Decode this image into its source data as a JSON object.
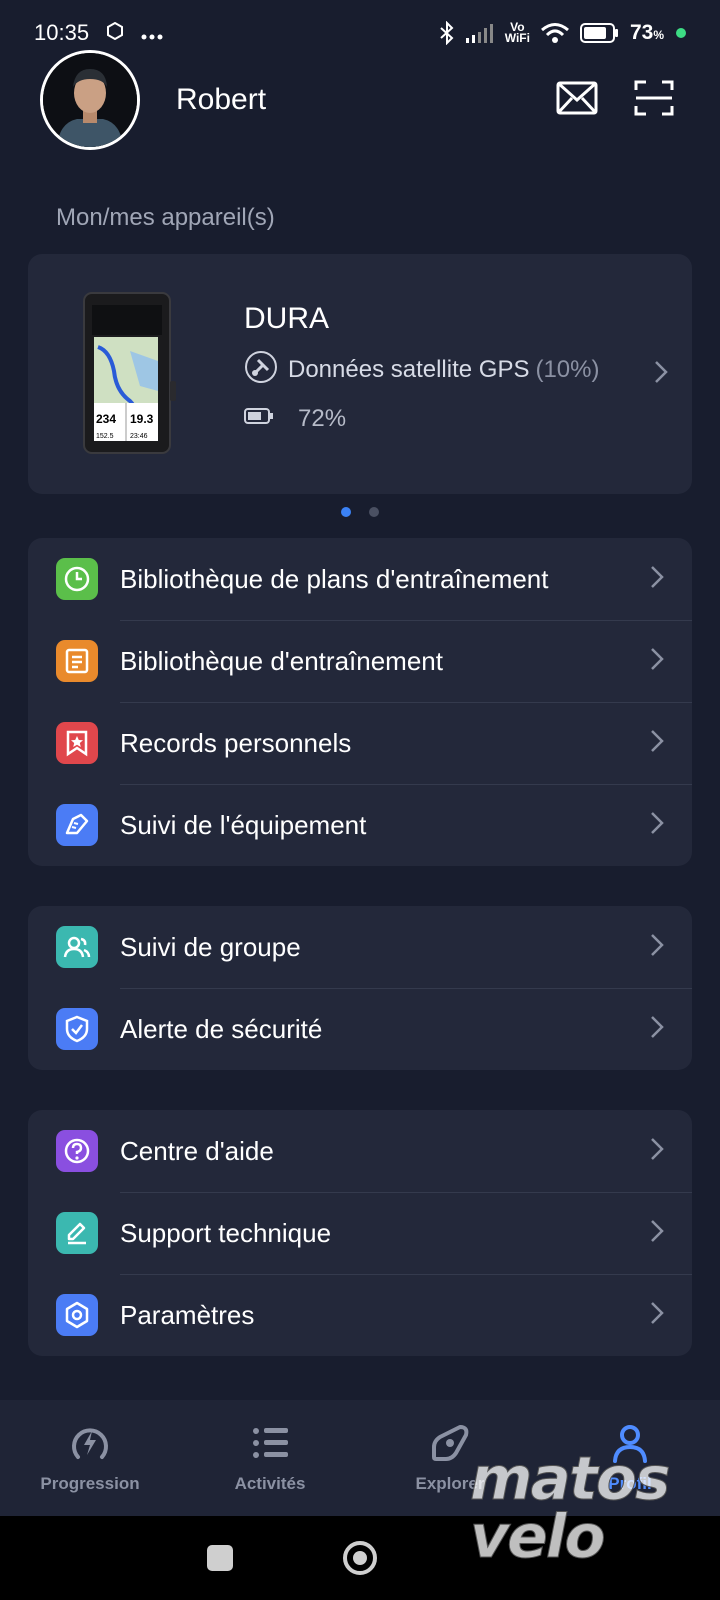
{
  "status_bar": {
    "time": "10:35",
    "vowifi_top": "Vo",
    "vowifi_bottom": "WiFi",
    "battery_percent": "73",
    "percent_sign": "%"
  },
  "header": {
    "username": "Robert",
    "icons": [
      "mail-icon",
      "scan-icon"
    ]
  },
  "devices_section": {
    "title": "Mon/mes appareil(s)",
    "device": {
      "name": "DURA",
      "gps_label": "Données satellite GPS",
      "gps_value": "(10%)",
      "battery": "72%",
      "screen_values": [
        "234",
        "19.3",
        "152.5",
        "23:46"
      ]
    },
    "pager": {
      "count": 2,
      "active": 0
    }
  },
  "menu_group_1": [
    {
      "label": "Bibliothèque de plans d'entraînement",
      "icon": "clock-icon",
      "color": "#5bbf4a"
    },
    {
      "label": "Bibliothèque d'entraînement",
      "icon": "document-icon",
      "color": "#e98a2c"
    },
    {
      "label": "Records personnels",
      "icon": "star-bookmark-icon",
      "color": "#e0474c"
    },
    {
      "label": "Suivi de l'équipement",
      "icon": "shoe-icon",
      "color": "#4b7cf5"
    }
  ],
  "menu_group_2": [
    {
      "label": "Suivi de groupe",
      "icon": "group-icon",
      "color": "#3bb8b0"
    },
    {
      "label": "Alerte de sécurité",
      "icon": "shield-check-icon",
      "color": "#4b7cf5"
    }
  ],
  "menu_group_3": [
    {
      "label": "Centre d'aide",
      "icon": "help-icon",
      "color": "#8a4fe0"
    },
    {
      "label": "Support technique",
      "icon": "pencil-icon",
      "color": "#3bb8b0"
    },
    {
      "label": "Paramètres",
      "icon": "settings-hexagon-icon",
      "color": "#4b7cf5"
    }
  ],
  "bottom_nav": [
    {
      "label": "Progression",
      "icon": "bolt-icon",
      "active": false
    },
    {
      "label": "Activités",
      "icon": "list-icon",
      "active": false
    },
    {
      "label": "Explorer",
      "icon": "compass-icon",
      "active": false
    },
    {
      "label": "Profil",
      "icon": "person-icon",
      "active": true
    }
  ],
  "watermark": {
    "line1": "matos",
    "line2": "velo"
  }
}
